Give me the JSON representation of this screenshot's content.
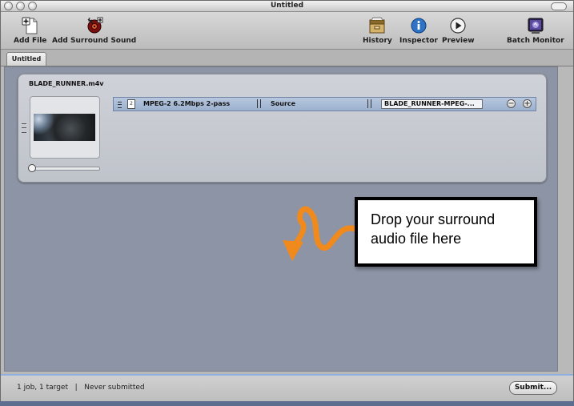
{
  "window": {
    "title": "Untitled"
  },
  "toolbar": {
    "add_file": "Add File",
    "add_surround": "Add Surround Sound",
    "history": "History",
    "inspector": "Inspector",
    "preview": "Preview",
    "batch_monitor": "Batch Monitor"
  },
  "tab": {
    "label": "Untitled"
  },
  "job": {
    "filename": "BLADE_RUNNER.m4v",
    "target": {
      "setting": "MPEG-2 6.2Mbps 2-pass",
      "location": "Source",
      "output": "BLADE_RUNNER-MPEG-..."
    }
  },
  "callout": {
    "text": "Drop your surround audio file here"
  },
  "status": {
    "summary": "1 job, 1 target",
    "separator": "|",
    "submitted": "Never submitted",
    "submit_label": "Submit..."
  },
  "colors": {
    "accent": "#f08a1c",
    "target_row": "#a9bcd7"
  }
}
